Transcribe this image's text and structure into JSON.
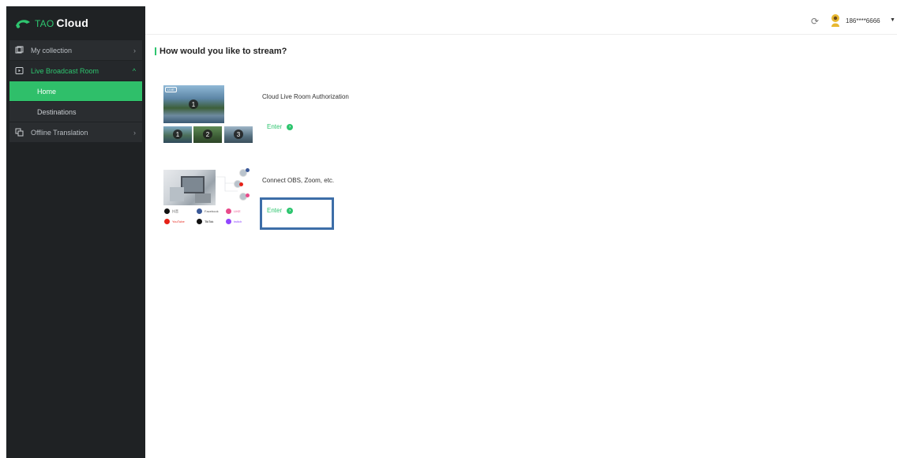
{
  "app": {
    "logo_prefix": "TAO",
    "logo_name": "Cloud"
  },
  "sidebar": {
    "items": [
      {
        "label": "My collection",
        "icon": "collection-icon"
      },
      {
        "label": "Live Broadcast Room",
        "icon": "live-room-icon",
        "active": true,
        "children": [
          {
            "label": "Home",
            "selected": true
          },
          {
            "label": "Destinations"
          }
        ]
      },
      {
        "label": "Offline Translation",
        "icon": "translation-icon"
      }
    ]
  },
  "header": {
    "user": "186****6666",
    "refresh_icon": "refresh-icon",
    "avatar_icon": "avatar-icon"
  },
  "main": {
    "heading": "How would you like to stream?",
    "cards": [
      {
        "title": "Cloud Live Room Authorization",
        "enter_label": "Enter",
        "live_tag": "LIVE",
        "numbers": [
          "1",
          "1",
          "2",
          "3"
        ]
      },
      {
        "title": "Connect OBS, Zoom, etc.",
        "enter_label": "Enter",
        "platforms": [
          "抖音",
          "Facebook",
          "LIKE",
          "YouTube",
          "TikTok",
          "twitch"
        ]
      }
    ]
  },
  "colors": {
    "accent": "#2ec56f",
    "sidebar_bg": "#1f2224",
    "highlight_box": "#3d6ea8"
  }
}
